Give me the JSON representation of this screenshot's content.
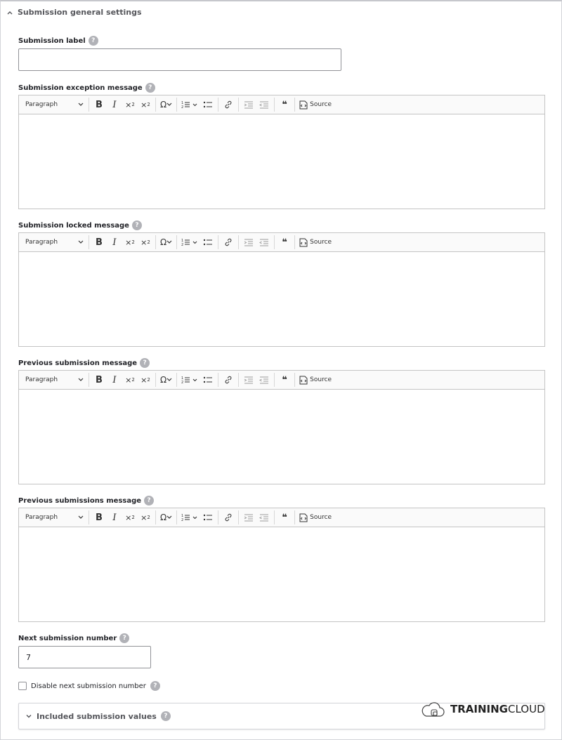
{
  "panel": {
    "title": "Submission general settings",
    "help_glyph": "?"
  },
  "fields": {
    "submission_label": {
      "label": "Submission label",
      "value": ""
    },
    "exception_message": {
      "label": "Submission exception message"
    },
    "locked_message": {
      "label": "Submission locked message"
    },
    "previous_message": {
      "label": "Previous submission message"
    },
    "previous_messages": {
      "label": "Previous submissions message"
    },
    "next_number": {
      "label": "Next submission number",
      "value": "7"
    },
    "disable_next": {
      "label": "Disable next submission number",
      "checked": false
    }
  },
  "toolbar": {
    "paragraph": "Paragraph",
    "source": "Source"
  },
  "included_values": {
    "title": "Included submission values"
  },
  "brand": {
    "part1": "TRAINING",
    "part2": "CLOUD"
  }
}
